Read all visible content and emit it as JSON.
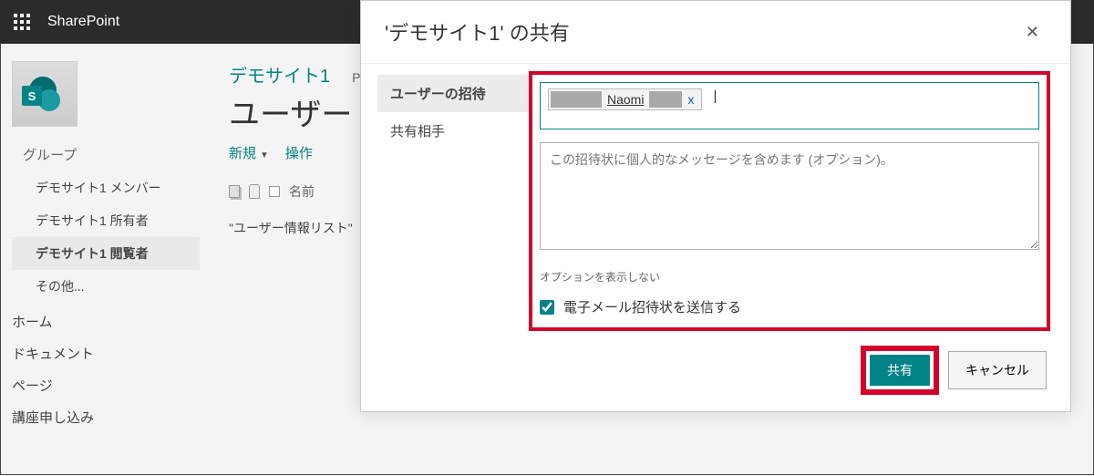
{
  "suitebar": {
    "brand": "SharePoint"
  },
  "site": {
    "title": "デモサイト1",
    "sub": "Pra",
    "page_title": "ユーザー"
  },
  "leftnav": {
    "section": "グループ",
    "items": [
      {
        "label": "デモサイト1 メンバー",
        "selected": false
      },
      {
        "label": "デモサイト1 所有者",
        "selected": false
      },
      {
        "label": "デモサイト1 閲覧者",
        "selected": true
      },
      {
        "label": "その他...",
        "selected": false
      }
    ],
    "roots": [
      "ホーム",
      "ドキュメント",
      "ページ",
      "講座申し込み"
    ]
  },
  "commands": {
    "new": "新規",
    "actions": "操作"
  },
  "list": {
    "col_name": "名前",
    "empty_msg": "\"ユーザー情報リスト\""
  },
  "modal": {
    "title": "'デモサイト1' の共有",
    "tabs": {
      "invite": "ユーザーの招待",
      "shared_with": "共有相手"
    },
    "chip_name": "Naomi",
    "chip_remove": "x",
    "message_placeholder": "この招待状に個人的なメッセージを含めます (オプション)。",
    "hide_options": "オプションを表示しない",
    "send_email": "電子メール招待状を送信する",
    "share_btn": "共有",
    "cancel_btn": "キャンセル"
  }
}
